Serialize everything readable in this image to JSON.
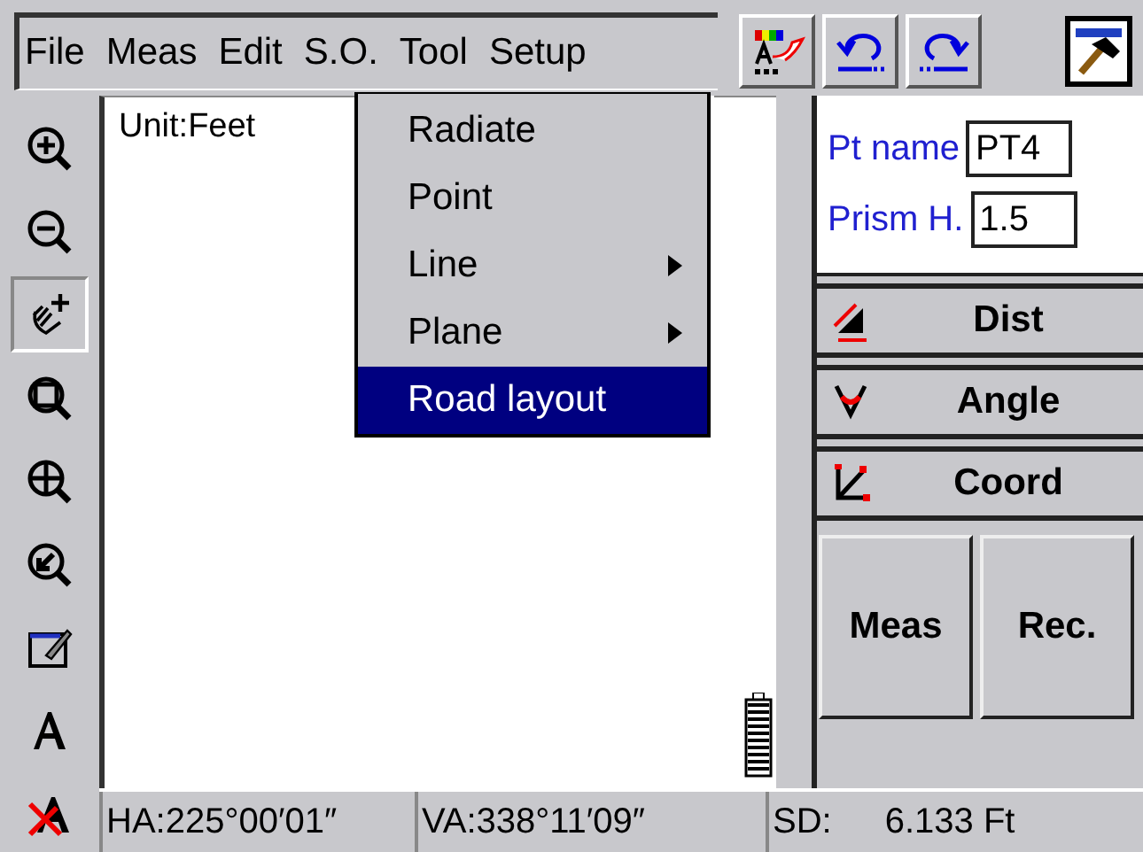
{
  "menu_bar": {
    "items": [
      "File",
      "Meas",
      "Edit",
      "S.O.",
      "Tool",
      "Setup"
    ]
  },
  "toolbar": [
    {
      "kind": "palette"
    },
    {
      "kind": "undo"
    },
    {
      "kind": "redo"
    }
  ],
  "app_button": {
    "kind": "hammer"
  },
  "dropdown": {
    "items": [
      {
        "label": "Radiate",
        "submenu": false,
        "selected": false
      },
      {
        "label": "Point",
        "submenu": false,
        "selected": false
      },
      {
        "label": "Line",
        "submenu": true,
        "selected": false
      },
      {
        "label": "Plane",
        "submenu": true,
        "selected": false
      },
      {
        "label": "Road layout",
        "submenu": false,
        "selected": true
      }
    ]
  },
  "left_tools": [
    {
      "kind": "zoom-in",
      "selected": false
    },
    {
      "kind": "zoom-out",
      "selected": false
    },
    {
      "kind": "pan",
      "selected": true
    },
    {
      "kind": "zoom-window",
      "selected": false
    },
    {
      "kind": "zoom-extents",
      "selected": false
    },
    {
      "kind": "zoom-previous",
      "selected": false
    },
    {
      "kind": "draw",
      "selected": false
    },
    {
      "kind": "text",
      "selected": false
    },
    {
      "kind": "text-off",
      "selected": false
    }
  ],
  "canvas": {
    "unit_label": "Unit:Feet"
  },
  "fields": [
    {
      "label": "Pt name",
      "value": "PT4"
    },
    {
      "label": "Prism H.",
      "value": "1.5"
    }
  ],
  "mode_buttons": [
    {
      "kind": "dist",
      "label": "Dist"
    },
    {
      "kind": "angle",
      "label": "Angle"
    },
    {
      "kind": "coord",
      "label": "Coord"
    }
  ],
  "action_buttons": [
    "Meas",
    "Rec."
  ],
  "status_bar": [
    {
      "label": "HA:225°00′01″"
    },
    {
      "label": "VA:338°11′09″"
    },
    {
      "label": "SD:",
      "value": "6.133 Ft"
    }
  ]
}
